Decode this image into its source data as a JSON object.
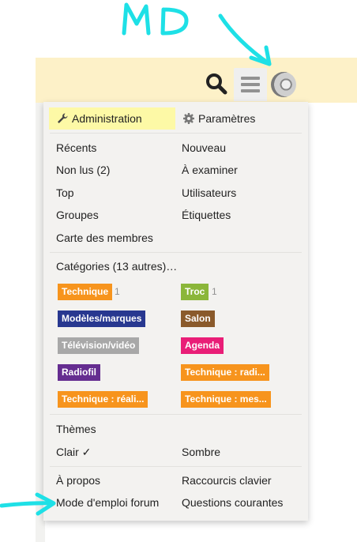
{
  "annotation": {
    "text": "MD",
    "color": "#1ee0e6"
  },
  "header": {
    "search_icon": "search-icon",
    "menu_icon": "hamburger-icon",
    "avatar_icon": "user-avatar"
  },
  "menu": {
    "tabs": [
      {
        "label": "Administration",
        "icon": "wrench-icon",
        "active": true
      },
      {
        "label": "Paramètres",
        "icon": "gear-icon",
        "active": false
      }
    ],
    "links": [
      [
        "Récents",
        "Nouveau"
      ],
      [
        "Non lus (2)",
        "À examiner"
      ],
      [
        "Top",
        "Utilisateurs"
      ],
      [
        "Groupes",
        "Étiquettes"
      ],
      [
        "Carte des membres",
        ""
      ]
    ],
    "categories_header": "Catégories (13 autres)…",
    "categories": [
      {
        "name": "Technique",
        "color": "#f7941d",
        "count": "1"
      },
      {
        "name": "Troc",
        "color": "#8bb63a",
        "count": "1"
      },
      {
        "name": "Modèles/marques",
        "color": "#283890",
        "count": ""
      },
      {
        "name": "Salon",
        "color": "#8a5a2b",
        "count": ""
      },
      {
        "name": "Télévision/vidéo",
        "color": "#a8a8a8",
        "count": ""
      },
      {
        "name": "Agenda",
        "color": "#e91e77",
        "count": ""
      },
      {
        "name": "Radiofil",
        "color": "#652d90",
        "count": ""
      },
      {
        "name": "Technique : radi...",
        "color": "#f7941d",
        "count": ""
      },
      {
        "name": "Technique : réali...",
        "color": "#f7941d",
        "count": ""
      },
      {
        "name": "Technique : mes...",
        "color": "#f7941d",
        "count": ""
      }
    ],
    "themes_header": "Thèmes",
    "theme_light": "Clair ✓",
    "theme_dark": "Sombre",
    "footer_links": [
      [
        "À propos",
        "Raccourcis clavier"
      ],
      [
        "Mode d'emploi forum",
        "Questions courantes"
      ]
    ]
  }
}
